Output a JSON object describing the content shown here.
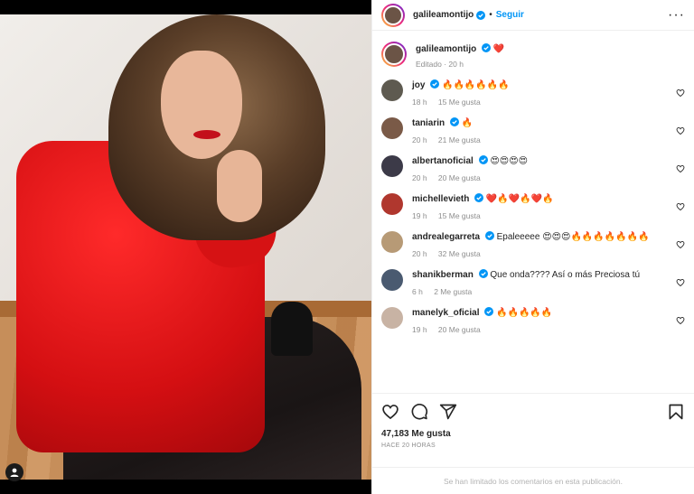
{
  "post": {
    "author": "galileamontijo",
    "follow_label": "Seguir",
    "separator": "•",
    "more_label": "···"
  },
  "caption": {
    "author": "galileamontijo",
    "text": "❤️",
    "meta": "Editado · 20 h"
  },
  "comments": [
    {
      "user": "joy",
      "text": "🔥🔥🔥🔥🔥🔥",
      "time": "18 h",
      "likes": "15 Me gusta",
      "avatar_color": "#5e5a50"
    },
    {
      "user": "taniarin",
      "text": "🔥",
      "time": "20 h",
      "likes": "21 Me gusta",
      "avatar_color": "#7a5a47"
    },
    {
      "user": "albertanoficial",
      "text": "😍😍😍😍",
      "time": "20 h",
      "likes": "20 Me gusta",
      "avatar_color": "#3c3a48"
    },
    {
      "user": "michellevieth",
      "text": "❤️🔥❤️🔥❤️🔥",
      "time": "19 h",
      "likes": "15 Me gusta",
      "avatar_color": "#b0372e"
    },
    {
      "user": "andrealegarreta",
      "text": "Epaleeeee 😍😍😍🔥🔥🔥🔥🔥🔥🔥",
      "time": "20 h",
      "likes": "32 Me gusta",
      "avatar_color": "#b79a76"
    },
    {
      "user": "shanikberman",
      "text": "Que onda???? Así o más Preciosa tú",
      "time": "6 h",
      "likes": "2 Me gusta",
      "avatar_color": "#4a5a70"
    },
    {
      "user": "manelyk_oficial",
      "text": "🔥🔥🔥🔥🔥",
      "time": "19 h",
      "likes": "20 Me gusta",
      "avatar_color": "#c8b3a4"
    }
  ],
  "likes_count": "47,183 Me gusta",
  "time_ago": "HACE 20 HORAS",
  "comments_limited": "Se han limitado los comentarios en esta publicación.",
  "colors": {
    "accent": "#0095f6",
    "verified": "#0095f6",
    "muted": "#8e8e8e"
  }
}
